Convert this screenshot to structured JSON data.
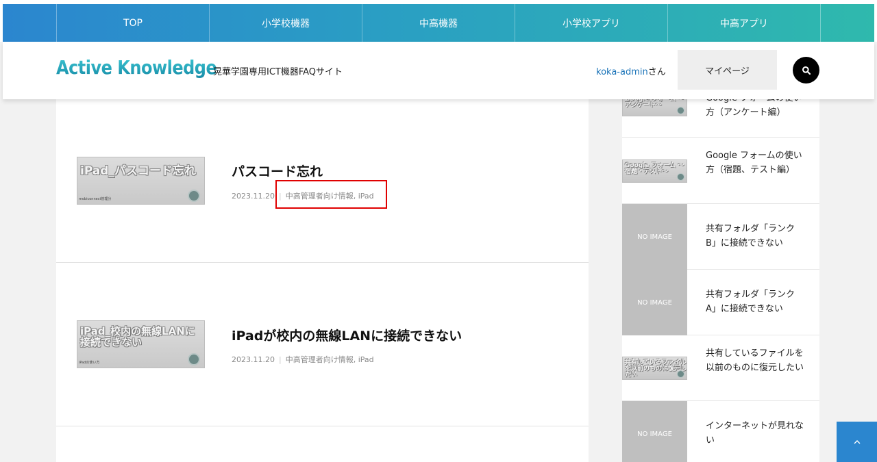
{
  "nav": {
    "items": [
      "TOP",
      "小学校機器",
      "中高機器",
      "小学校アプリ",
      "中高アプリ"
    ]
  },
  "header": {
    "logo": "Active Knowledge",
    "tagline": "晃華学園専用ICT機器FAQサイト",
    "username": "koka-admin",
    "honorific": "さん",
    "mypage_label": "マイページ"
  },
  "articles": [
    {
      "title": "パスコード忘れ",
      "date": "2023.11.20",
      "categories": "中高管理者向け情報, iPad",
      "thumb_title": "iPad_パスコード忘れ",
      "thumb_sub": "mobiconnect管理分"
    },
    {
      "title": "iPadが校内の無線LANに接続できない",
      "date": "2023.11.20",
      "categories": "中高管理者向け情報, iPad",
      "thumb_title": "iPad_校内の無線LANに接続できない",
      "thumb_sub": "iPadの使い方"
    }
  ],
  "sidebar": {
    "items": [
      {
        "text": "Google フォームの使い方（アンケート編）",
        "thumb": "Google フォーム ～アンケート～",
        "noimage": false
      },
      {
        "text": "Google フォームの使い方（宿題、テスト編）",
        "thumb": "Google フォーム ～宿題・テスト～",
        "noimage": false
      },
      {
        "text": "共有フォルダ「ランクB」に接続できない",
        "thumb": "NO IMAGE",
        "noimage": true
      },
      {
        "text": "共有フォルダ「ランクA」に接続できない",
        "thumb": "NO IMAGE",
        "noimage": true
      },
      {
        "text": "共有しているファイルを以前のものに復元したい",
        "thumb": "共有しているファイルを以前のものに復元したい",
        "noimage": false
      },
      {
        "text": "インターネットが見れない",
        "thumb": "NO IMAGE",
        "noimage": true
      }
    ]
  },
  "colors": {
    "nav_gradient_start": "#2b86cf",
    "nav_gradient_end": "#2fb9ad",
    "highlight": "#e00000",
    "link": "#1a73b8"
  },
  "icons": {
    "search": "search-icon",
    "back_to_top": "chevron-up-icon"
  }
}
